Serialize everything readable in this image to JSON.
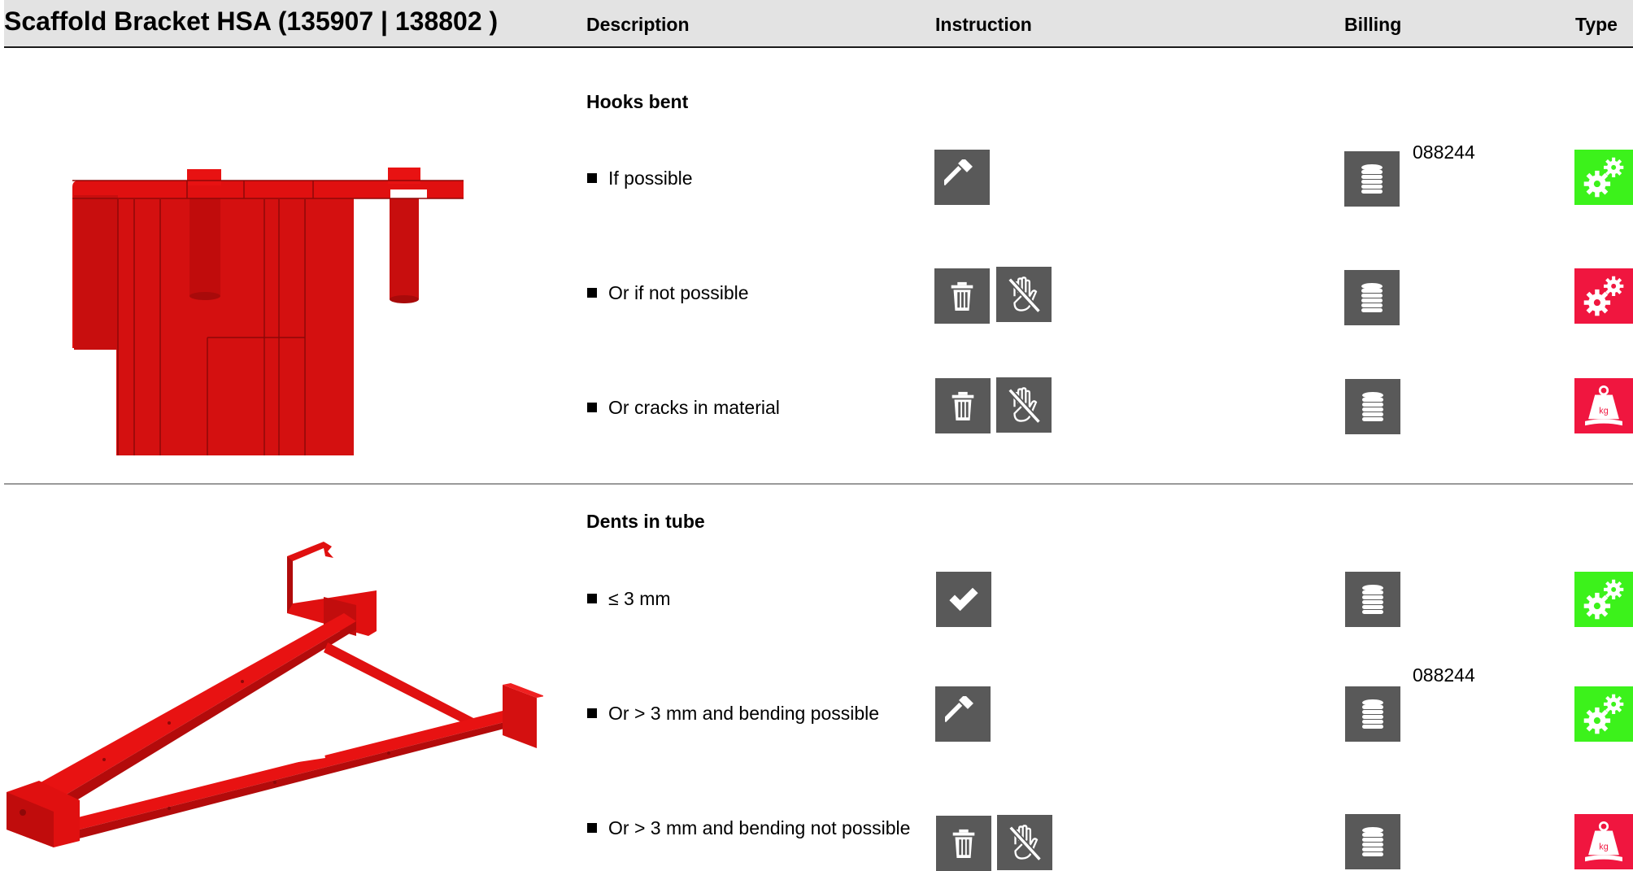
{
  "header": {
    "title": "Scaffold Bracket HSA (135907 | 138802 )",
    "col_description": "Description",
    "col_instruction": "Instruction",
    "col_billing": "Billing",
    "col_type": "Type"
  },
  "sections": [
    {
      "title": "Hooks bent",
      "rows": [
        {
          "label": "If possible",
          "instruction_icons": [
            "hammer-icon"
          ],
          "billing_icon": "coin-stack-icon",
          "billing_code": "088244",
          "type_icon": "gears-icon",
          "type_color": "#3cf21b"
        },
        {
          "label": "Or if not possible",
          "instruction_icons": [
            "trash-icon",
            "no-hand-icon"
          ],
          "billing_icon": "coin-stack-icon",
          "billing_code": "",
          "type_icon": "gears-icon",
          "type_color": "#f0163f"
        },
        {
          "label": "Or cracks in material",
          "instruction_icons": [
            "trash-icon",
            "no-hand-icon"
          ],
          "billing_icon": "coin-stack-icon",
          "billing_code": "",
          "type_icon": "weight-kg-icon",
          "type_color": "#f0163f"
        }
      ]
    },
    {
      "title": "Dents in tube",
      "rows": [
        {
          "label": "≤ 3 mm",
          "instruction_icons": [
            "checkmark-icon"
          ],
          "billing_icon": "coin-stack-icon",
          "billing_code": "",
          "type_icon": "gears-icon",
          "type_color": "#3cf21b"
        },
        {
          "label": "Or > 3 mm and bending possible",
          "instruction_icons": [
            "hammer-icon"
          ],
          "billing_icon": "coin-stack-icon",
          "billing_code": "088244",
          "type_icon": "gears-icon",
          "type_color": "#3cf21b"
        },
        {
          "label": "Or > 3 mm and bending not possible",
          "instruction_icons": [
            "trash-icon",
            "no-hand-icon"
          ],
          "billing_icon": "coin-stack-icon",
          "billing_code": "",
          "type_icon": "weight-kg-icon",
          "type_color": "#f0163f"
        }
      ]
    }
  ],
  "weight_label": "kg",
  "illustrations": [
    "bracket-hook-closeup-illustration",
    "bracket-full-view-illustration"
  ]
}
